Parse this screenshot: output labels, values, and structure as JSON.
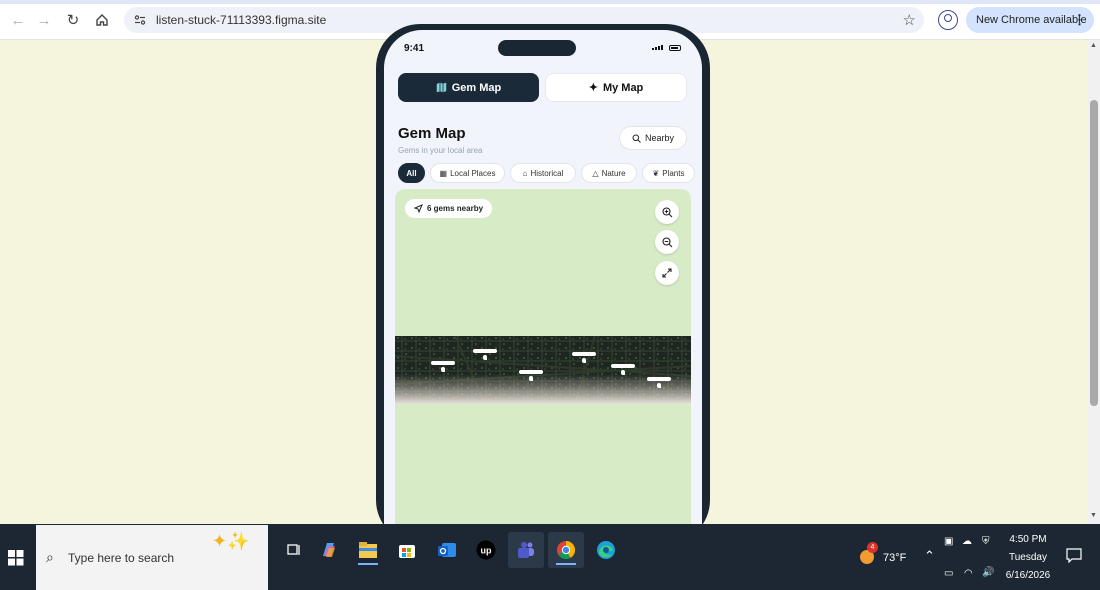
{
  "browser": {
    "url": "listen-stuck-71113393.figma.site",
    "update_label": "New Chrome available"
  },
  "phone": {
    "time": "9:41",
    "tabs": [
      {
        "label": "Gem Map",
        "icon": "map-icon",
        "active": true
      },
      {
        "label": "My Map",
        "icon": "sparkle-icon",
        "active": false
      }
    ],
    "title": "Gem Map",
    "subtitle": "Gems in your local area",
    "nearby_label": "Nearby",
    "chips": [
      {
        "label": "All",
        "active": true
      },
      {
        "label": "Local Places",
        "icon": "building-icon"
      },
      {
        "label": "Historical",
        "icon": "landmark-icon"
      },
      {
        "label": "Nature",
        "icon": "tree-icon"
      },
      {
        "label": "Plants",
        "icon": "leaf-icon"
      }
    ],
    "gems_badge": "6 gems nearby"
  },
  "taskbar": {
    "search_placeholder": "Type here to search",
    "weather": "73°F",
    "weather_badge": "4",
    "time": "4:50 PM",
    "day": "Tuesday",
    "date": "6/16/2026"
  },
  "colors": {
    "page_bg": "#f5f4dd",
    "phone_frame": "#1a2732",
    "active_tab": "#1a2a38",
    "map_green": "#d7ebc6",
    "taskbar": "#1c2733"
  }
}
